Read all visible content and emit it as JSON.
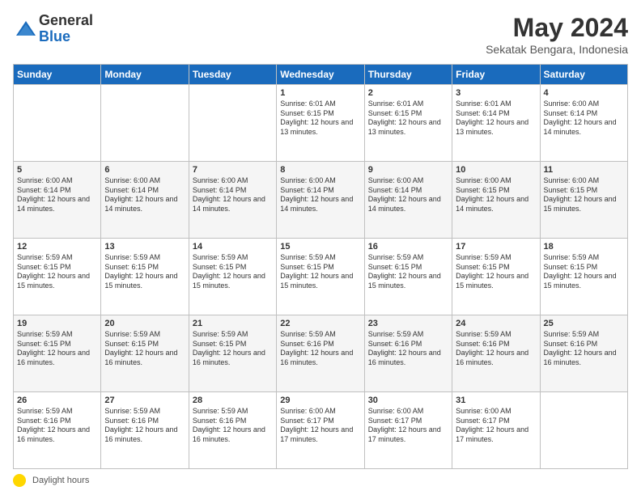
{
  "header": {
    "logo_general": "General",
    "logo_blue": "Blue",
    "month_year": "May 2024",
    "location": "Sekatak Bengara, Indonesia"
  },
  "days_of_week": [
    "Sunday",
    "Monday",
    "Tuesday",
    "Wednesday",
    "Thursday",
    "Friday",
    "Saturday"
  ],
  "footer": {
    "icon_label": "daylight-icon",
    "text": "Daylight hours"
  },
  "weeks": [
    [
      {
        "day": "",
        "sunrise": "",
        "sunset": "",
        "daylight": ""
      },
      {
        "day": "",
        "sunrise": "",
        "sunset": "",
        "daylight": ""
      },
      {
        "day": "",
        "sunrise": "",
        "sunset": "",
        "daylight": ""
      },
      {
        "day": "1",
        "sunrise": "Sunrise: 6:01 AM",
        "sunset": "Sunset: 6:15 PM",
        "daylight": "Daylight: 12 hours and 13 minutes."
      },
      {
        "day": "2",
        "sunrise": "Sunrise: 6:01 AM",
        "sunset": "Sunset: 6:15 PM",
        "daylight": "Daylight: 12 hours and 13 minutes."
      },
      {
        "day": "3",
        "sunrise": "Sunrise: 6:01 AM",
        "sunset": "Sunset: 6:14 PM",
        "daylight": "Daylight: 12 hours and 13 minutes."
      },
      {
        "day": "4",
        "sunrise": "Sunrise: 6:00 AM",
        "sunset": "Sunset: 6:14 PM",
        "daylight": "Daylight: 12 hours and 14 minutes."
      }
    ],
    [
      {
        "day": "5",
        "sunrise": "Sunrise: 6:00 AM",
        "sunset": "Sunset: 6:14 PM",
        "daylight": "Daylight: 12 hours and 14 minutes."
      },
      {
        "day": "6",
        "sunrise": "Sunrise: 6:00 AM",
        "sunset": "Sunset: 6:14 PM",
        "daylight": "Daylight: 12 hours and 14 minutes."
      },
      {
        "day": "7",
        "sunrise": "Sunrise: 6:00 AM",
        "sunset": "Sunset: 6:14 PM",
        "daylight": "Daylight: 12 hours and 14 minutes."
      },
      {
        "day": "8",
        "sunrise": "Sunrise: 6:00 AM",
        "sunset": "Sunset: 6:14 PM",
        "daylight": "Daylight: 12 hours and 14 minutes."
      },
      {
        "day": "9",
        "sunrise": "Sunrise: 6:00 AM",
        "sunset": "Sunset: 6:14 PM",
        "daylight": "Daylight: 12 hours and 14 minutes."
      },
      {
        "day": "10",
        "sunrise": "Sunrise: 6:00 AM",
        "sunset": "Sunset: 6:15 PM",
        "daylight": "Daylight: 12 hours and 14 minutes."
      },
      {
        "day": "11",
        "sunrise": "Sunrise: 6:00 AM",
        "sunset": "Sunset: 6:15 PM",
        "daylight": "Daylight: 12 hours and 15 minutes."
      }
    ],
    [
      {
        "day": "12",
        "sunrise": "Sunrise: 5:59 AM",
        "sunset": "Sunset: 6:15 PM",
        "daylight": "Daylight: 12 hours and 15 minutes."
      },
      {
        "day": "13",
        "sunrise": "Sunrise: 5:59 AM",
        "sunset": "Sunset: 6:15 PM",
        "daylight": "Daylight: 12 hours and 15 minutes."
      },
      {
        "day": "14",
        "sunrise": "Sunrise: 5:59 AM",
        "sunset": "Sunset: 6:15 PM",
        "daylight": "Daylight: 12 hours and 15 minutes."
      },
      {
        "day": "15",
        "sunrise": "Sunrise: 5:59 AM",
        "sunset": "Sunset: 6:15 PM",
        "daylight": "Daylight: 12 hours and 15 minutes."
      },
      {
        "day": "16",
        "sunrise": "Sunrise: 5:59 AM",
        "sunset": "Sunset: 6:15 PM",
        "daylight": "Daylight: 12 hours and 15 minutes."
      },
      {
        "day": "17",
        "sunrise": "Sunrise: 5:59 AM",
        "sunset": "Sunset: 6:15 PM",
        "daylight": "Daylight: 12 hours and 15 minutes."
      },
      {
        "day": "18",
        "sunrise": "Sunrise: 5:59 AM",
        "sunset": "Sunset: 6:15 PM",
        "daylight": "Daylight: 12 hours and 15 minutes."
      }
    ],
    [
      {
        "day": "19",
        "sunrise": "Sunrise: 5:59 AM",
        "sunset": "Sunset: 6:15 PM",
        "daylight": "Daylight: 12 hours and 16 minutes."
      },
      {
        "day": "20",
        "sunrise": "Sunrise: 5:59 AM",
        "sunset": "Sunset: 6:15 PM",
        "daylight": "Daylight: 12 hours and 16 minutes."
      },
      {
        "day": "21",
        "sunrise": "Sunrise: 5:59 AM",
        "sunset": "Sunset: 6:15 PM",
        "daylight": "Daylight: 12 hours and 16 minutes."
      },
      {
        "day": "22",
        "sunrise": "Sunrise: 5:59 AM",
        "sunset": "Sunset: 6:16 PM",
        "daylight": "Daylight: 12 hours and 16 minutes."
      },
      {
        "day": "23",
        "sunrise": "Sunrise: 5:59 AM",
        "sunset": "Sunset: 6:16 PM",
        "daylight": "Daylight: 12 hours and 16 minutes."
      },
      {
        "day": "24",
        "sunrise": "Sunrise: 5:59 AM",
        "sunset": "Sunset: 6:16 PM",
        "daylight": "Daylight: 12 hours and 16 minutes."
      },
      {
        "day": "25",
        "sunrise": "Sunrise: 5:59 AM",
        "sunset": "Sunset: 6:16 PM",
        "daylight": "Daylight: 12 hours and 16 minutes."
      }
    ],
    [
      {
        "day": "26",
        "sunrise": "Sunrise: 5:59 AM",
        "sunset": "Sunset: 6:16 PM",
        "daylight": "Daylight: 12 hours and 16 minutes."
      },
      {
        "day": "27",
        "sunrise": "Sunrise: 5:59 AM",
        "sunset": "Sunset: 6:16 PM",
        "daylight": "Daylight: 12 hours and 16 minutes."
      },
      {
        "day": "28",
        "sunrise": "Sunrise: 5:59 AM",
        "sunset": "Sunset: 6:16 PM",
        "daylight": "Daylight: 12 hours and 16 minutes."
      },
      {
        "day": "29",
        "sunrise": "Sunrise: 6:00 AM",
        "sunset": "Sunset: 6:17 PM",
        "daylight": "Daylight: 12 hours and 17 minutes."
      },
      {
        "day": "30",
        "sunrise": "Sunrise: 6:00 AM",
        "sunset": "Sunset: 6:17 PM",
        "daylight": "Daylight: 12 hours and 17 minutes."
      },
      {
        "day": "31",
        "sunrise": "Sunrise: 6:00 AM",
        "sunset": "Sunset: 6:17 PM",
        "daylight": "Daylight: 12 hours and 17 minutes."
      },
      {
        "day": "",
        "sunrise": "",
        "sunset": "",
        "daylight": ""
      }
    ]
  ]
}
